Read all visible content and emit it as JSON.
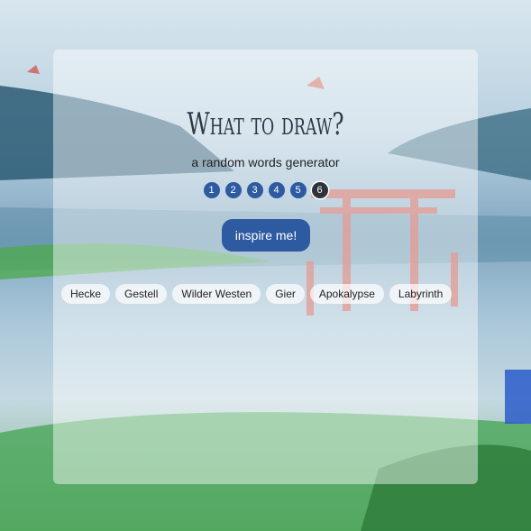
{
  "header": {
    "title": "What to draw?",
    "subtitle": "a random words generator"
  },
  "word_count": {
    "options": [
      "1",
      "2",
      "3",
      "4",
      "5",
      "6"
    ],
    "selected": "6"
  },
  "actions": {
    "inspire_label": "inspire me!"
  },
  "words": [
    "Hecke",
    "Gestell",
    "Wilder Westen",
    "Gier",
    "Apokalypse",
    "Labyrinth"
  ],
  "colors": {
    "accent": "#2d5aa0",
    "active_count": "#2f3338"
  }
}
